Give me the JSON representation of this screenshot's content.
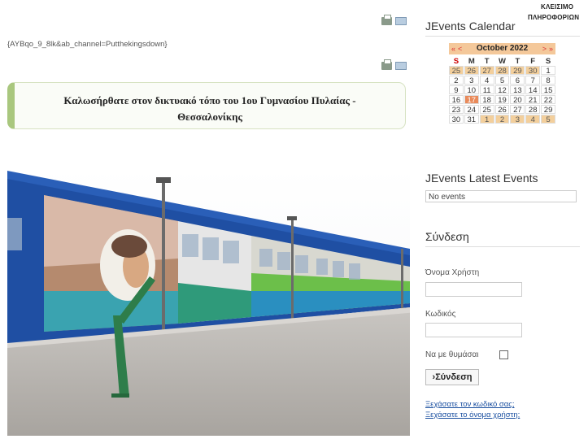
{
  "main": {
    "code_line": "{AYBqo_9_8lk&ab_channel=Putthekingsdown}",
    "welcome_line1": "Καλωσήρθατε στον δικτυακό τόπο του 1ου Γυμνασίου Πυλαίας -",
    "welcome_line2": "Θεσσαλονίκης"
  },
  "sidebar": {
    "logo_line1": "ΚΛΕΙΣΙΜΟ",
    "logo_line2": "ΠΛΗΡΟΦΟΡΙΩΝ",
    "calendar_title": "JEvents Calendar",
    "calendar": {
      "prev_year": "«",
      "prev_month": "<",
      "month_label": "October 2022",
      "next_month": ">",
      "next_year": "»",
      "day_names": [
        "S",
        "M",
        "T",
        "W",
        "T",
        "F",
        "S"
      ],
      "weeks": [
        [
          "25",
          "26",
          "27",
          "28",
          "29",
          "30",
          "1"
        ],
        [
          "2",
          "3",
          "4",
          "5",
          "6",
          "7",
          "8"
        ],
        [
          "9",
          "10",
          "11",
          "12",
          "13",
          "14",
          "15"
        ],
        [
          "16",
          "17",
          "18",
          "19",
          "20",
          "21",
          "22"
        ],
        [
          "23",
          "24",
          "25",
          "26",
          "27",
          "28",
          "29"
        ],
        [
          "30",
          "31",
          "1",
          "2",
          "3",
          "4",
          "5"
        ]
      ],
      "today": "17"
    },
    "latest_title": "JEvents Latest Events",
    "no_events": "No events",
    "login_title": "Σύνδεση",
    "username_label": "Όνομα Χρήστη",
    "password_label": "Κωδικός",
    "remember_label": "Να με θυμάσαι",
    "login_button": "›Σύνδεση",
    "forgot_password": "Ξεχάσατε τον κωδικό σας;",
    "forgot_username": "Ξεχάσατε το όνομα χρήστη;"
  },
  "colors": {
    "accent_green": "#a9c77e",
    "calendar_orange": "#f4c89a",
    "today": "#e98a5a",
    "link": "#1a4fa0"
  }
}
